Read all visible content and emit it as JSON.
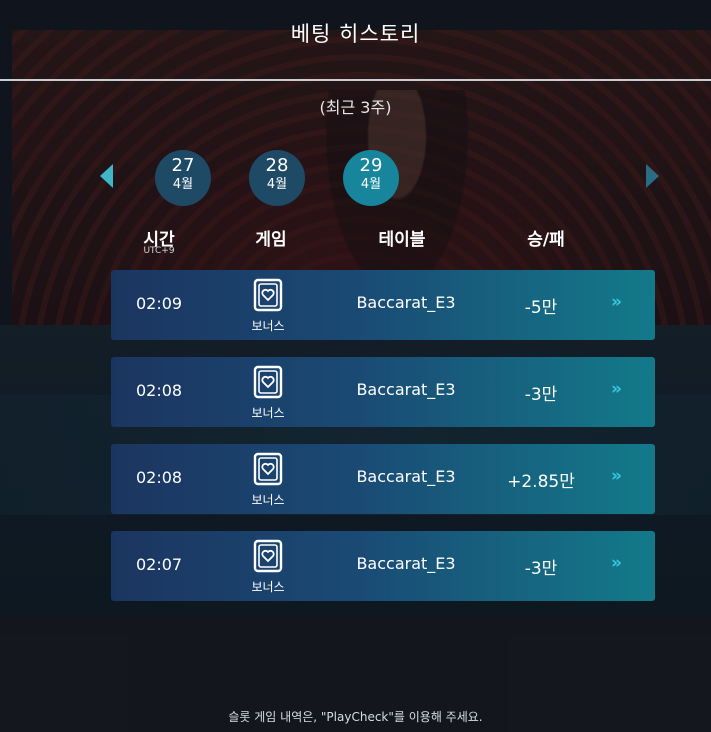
{
  "header": {
    "title": "베팅 히스토리",
    "subtitle": "(최근 3주)"
  },
  "dates": [
    {
      "day": "27",
      "month": "4월"
    },
    {
      "day": "28",
      "month": "4월"
    },
    {
      "day": "29",
      "month": "4월"
    }
  ],
  "selected_date": "29",
  "columns": {
    "time": "시간",
    "timezone": "UTC+9",
    "game": "게임",
    "table": "테이블",
    "result": "승/패"
  },
  "rows": [
    {
      "time": "02:09",
      "game": "보너스",
      "table": "Baccarat_E3",
      "result": "-5만"
    },
    {
      "time": "02:08",
      "game": "보너스",
      "table": "Baccarat_E3",
      "result": "-3만"
    },
    {
      "time": "02:08",
      "game": "보너스",
      "table": "Baccarat_E3",
      "result": "+2.85만"
    },
    {
      "time": "02:07",
      "game": "보너스",
      "table": "Baccarat_E3",
      "result": "-3만"
    }
  ],
  "chevron_glyph": "»",
  "footer": "슬롯 게임 내역은, \"PlayCheck\"를 이용해 주세요.",
  "colors": {
    "accent": "#35c8df",
    "date_active": "#17859b",
    "date_inactive": "#1e4a66"
  }
}
